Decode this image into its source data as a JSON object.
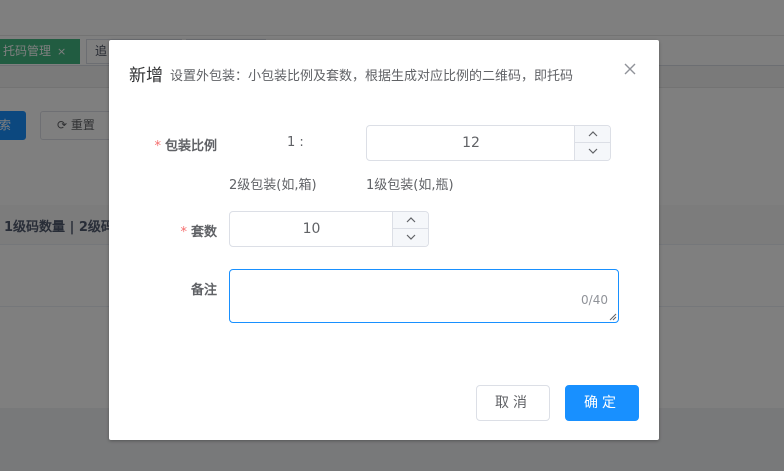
{
  "background": {
    "tabs": [
      {
        "label": "托码管理",
        "close": "×",
        "active": true
      },
      {
        "label": "追",
        "close": "",
        "active": false
      },
      {
        "label": "",
        "close": "",
        "active": false
      }
    ],
    "search_button": "索",
    "reset_button": "重置",
    "table_header": "1级码数量 | 2级码"
  },
  "dialog": {
    "title": "新增",
    "subtitle": "设置外包装：小包装比例及套数，根据生成对应比例的二维码，即托码",
    "close_icon": "close-icon",
    "ratio": {
      "required_mark": "*",
      "label": "包装比例",
      "left_value": "1 :",
      "right_value": "12",
      "left_caption": "2级包装(如,箱)",
      "right_caption": "1级包装(如,瓶)"
    },
    "sets": {
      "required_mark": "*",
      "label": "套数",
      "value": "10"
    },
    "remark": {
      "label": "备注",
      "value": "",
      "word_count": "0/40"
    },
    "cancel_label": "取消",
    "confirm_label": "确定",
    "colors": {
      "primary": "#1890ff",
      "required": "#f56c6c",
      "tab_active": "#42b983"
    }
  }
}
